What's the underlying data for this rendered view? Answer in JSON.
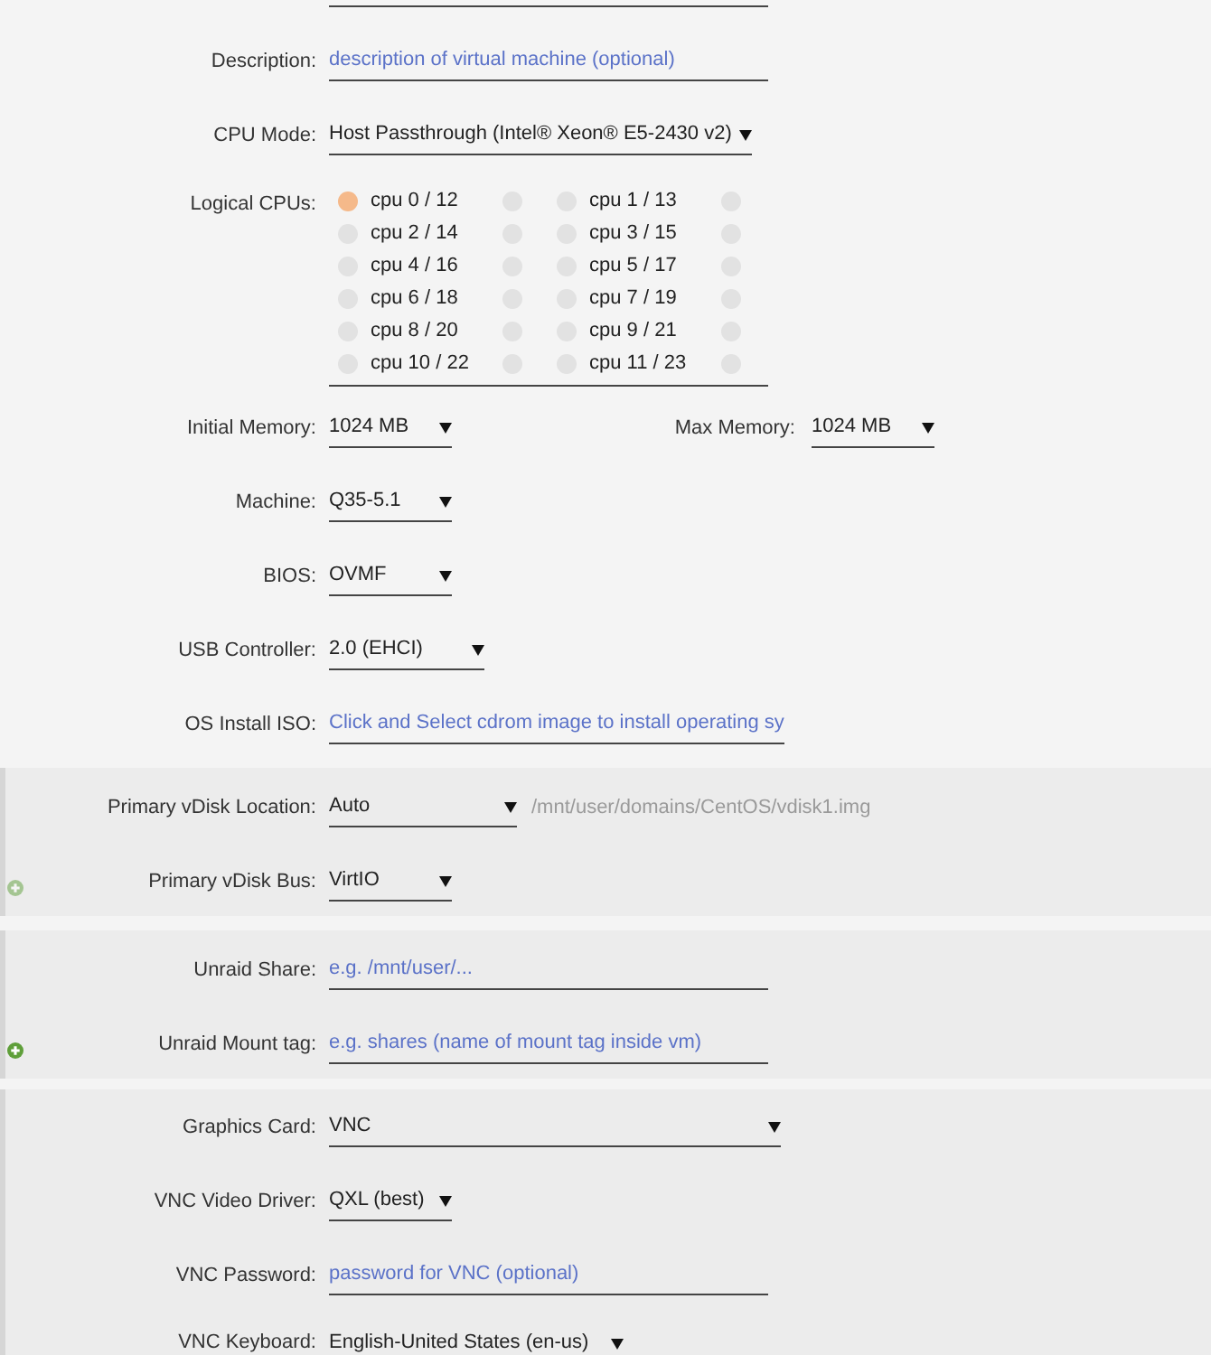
{
  "sections": [
    {
      "rows": [
        {
          "kind": "text",
          "label": "Description:",
          "placeholder": "description of virtual machine (optional)"
        },
        {
          "kind": "select",
          "label": "CPU Mode:",
          "value": "Host Passthrough (Intel® Xeon® E5-2430 v2)"
        },
        {
          "kind": "cpus",
          "label": "Logical CPUs:",
          "cpus": [
            {
              "label": "cpu 0 / 12",
              "threads": [
                {
                  "checked": true
                },
                {
                  "checked": false
                }
              ]
            },
            {
              "label": "cpu 1 / 13",
              "threads": [
                {
                  "checked": false
                },
                {
                  "checked": false
                }
              ]
            },
            {
              "label": "cpu 2 / 14",
              "threads": [
                {
                  "checked": false
                },
                {
                  "checked": false
                }
              ]
            },
            {
              "label": "cpu 3 / 15",
              "threads": [
                {
                  "checked": false
                },
                {
                  "checked": false
                }
              ]
            },
            {
              "label": "cpu 4 / 16",
              "threads": [
                {
                  "checked": false
                },
                {
                  "checked": false
                }
              ]
            },
            {
              "label": "cpu 5 / 17",
              "threads": [
                {
                  "checked": false
                },
                {
                  "checked": false
                }
              ]
            },
            {
              "label": "cpu 6 / 18",
              "threads": [
                {
                  "checked": false
                },
                {
                  "checked": false
                }
              ]
            },
            {
              "label": "cpu 7 / 19",
              "threads": [
                {
                  "checked": false
                },
                {
                  "checked": false
                }
              ]
            },
            {
              "label": "cpu 8 / 20",
              "threads": [
                {
                  "checked": false
                },
                {
                  "checked": false
                }
              ]
            },
            {
              "label": "cpu 9 / 21",
              "threads": [
                {
                  "checked": false
                },
                {
                  "checked": false
                }
              ]
            },
            {
              "label": "cpu 10 / 22",
              "threads": [
                {
                  "checked": false
                },
                {
                  "checked": false
                }
              ]
            },
            {
              "label": "cpu 11 / 23",
              "threads": [
                {
                  "checked": false
                },
                {
                  "checked": false
                }
              ]
            }
          ]
        },
        {
          "kind": "select",
          "label": "Initial Memory:",
          "value": "1024 MB",
          "pair": {
            "label": "Max Memory:",
            "value": "1024 MB"
          }
        },
        {
          "kind": "select",
          "label": "Machine:",
          "value": "Q35-5.1"
        },
        {
          "kind": "select",
          "label": "BIOS:",
          "value": "OVMF"
        },
        {
          "kind": "select",
          "label": "USB Controller:",
          "value": "2.0 (EHCI)"
        },
        {
          "kind": "text",
          "label": "OS Install ISO:",
          "placeholder": "Click and Select cdrom image to install operating sy"
        }
      ]
    },
    {
      "rows": [
        {
          "kind": "select",
          "label": "Primary vDisk Location:",
          "value": "Auto",
          "note": "/mnt/user/domains/CentOS/vdisk1.img"
        },
        {
          "kind": "select",
          "label": "Primary vDisk Bus:",
          "value": "VirtIO"
        }
      ],
      "add_button": {
        "disabled": true
      }
    },
    {
      "rows": [
        {
          "kind": "text",
          "label": "Unraid Share:",
          "placeholder": "e.g. /mnt/user/..."
        },
        {
          "kind": "text",
          "label": "Unraid Mount tag:",
          "placeholder": "e.g. shares (name of mount tag inside vm)"
        }
      ],
      "add_button": {
        "disabled": false
      }
    },
    {
      "rows": [
        {
          "kind": "select",
          "label": "Graphics Card:",
          "value": "VNC"
        },
        {
          "kind": "select",
          "label": "VNC Video Driver:",
          "value": "QXL (best)"
        },
        {
          "kind": "text",
          "label": "VNC Password:",
          "placeholder": "password for VNC (optional)"
        },
        {
          "kind": "select",
          "label": "VNC Keyboard:",
          "value": "English-United States (en-us)"
        }
      ]
    }
  ]
}
